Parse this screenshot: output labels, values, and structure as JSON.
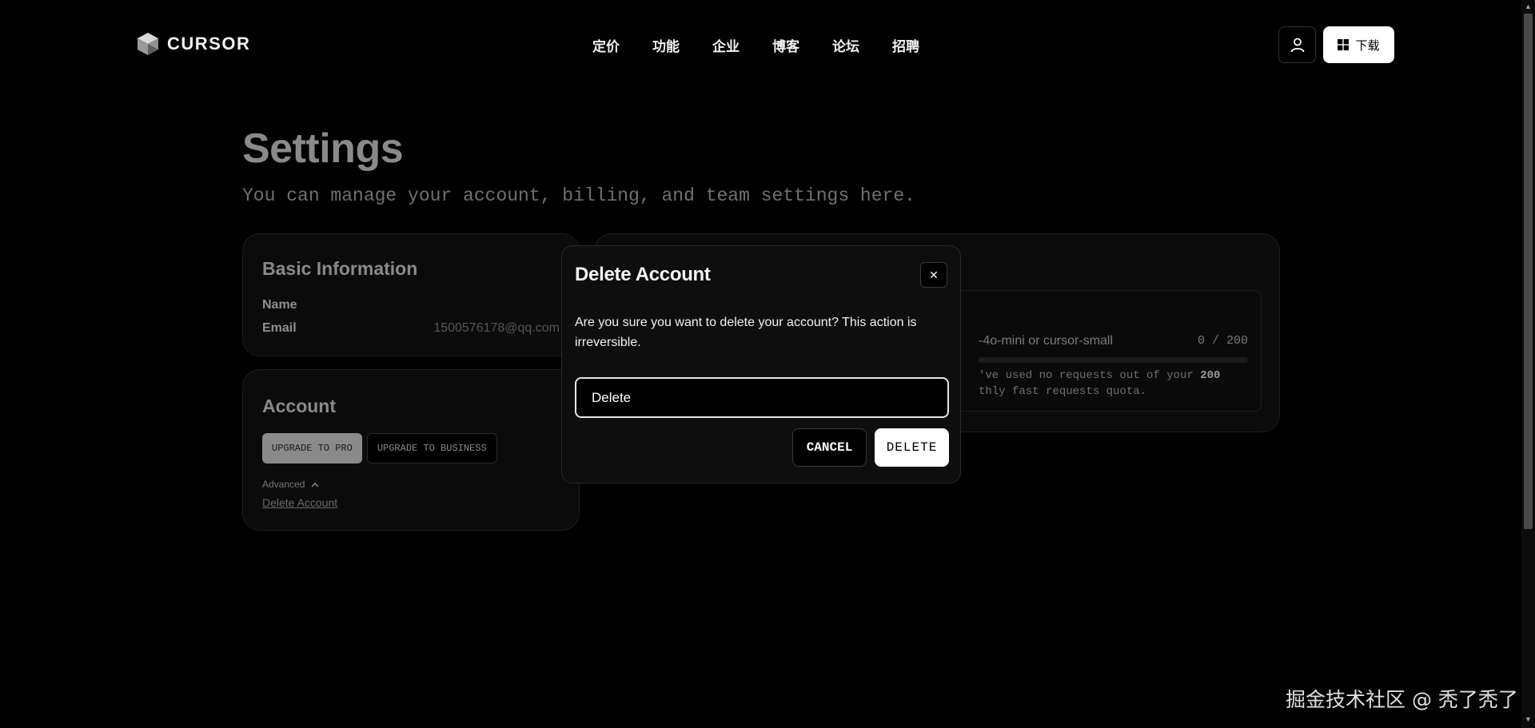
{
  "header": {
    "logo_text": "CURSOR",
    "nav": [
      "定价",
      "功能",
      "企业",
      "博客",
      "论坛",
      "招聘"
    ],
    "download_label": "下载",
    "icons": {
      "logo": "cube-logo-icon",
      "user": "user-icon",
      "windows": "windows-icon"
    }
  },
  "settings": {
    "title": "Settings",
    "subtitle": "You can manage your account, billing, and team settings here."
  },
  "basic_info": {
    "title": "Basic Information",
    "name_label": "Name",
    "email_label": "Email",
    "email_value": "1500576178@qq.com"
  },
  "account": {
    "title": "Account",
    "upgrade_pro": "UPGRADE TO PRO",
    "upgrade_business": "UPGRADE TO BUSINESS",
    "advanced": "Advanced",
    "delete_link": "Delete Account"
  },
  "usage": {
    "model_partial": "-4o-mini or cursor-small",
    "count": "0 / 200",
    "progress_fraction": 0,
    "note_line1_prefix": "'ve used no requests out of your ",
    "note_line1_bold": "200",
    "note_line2": "thly fast requests quota."
  },
  "dialog": {
    "title": "Delete Account",
    "message": "Are you sure you want to delete your account? This action is irreversible.",
    "input_value": "Delete",
    "cancel_label": "CANCEL",
    "delete_label": "DELETE",
    "close_glyph": "✕"
  },
  "watermark": "掘金技术社区 @ 秃了秃了",
  "colors": {
    "background": "#000000",
    "card": "#0b0b0b",
    "dialog": "#0e0e0e",
    "primary_button": "#ffffff",
    "muted_text": "#8a8a8a"
  }
}
